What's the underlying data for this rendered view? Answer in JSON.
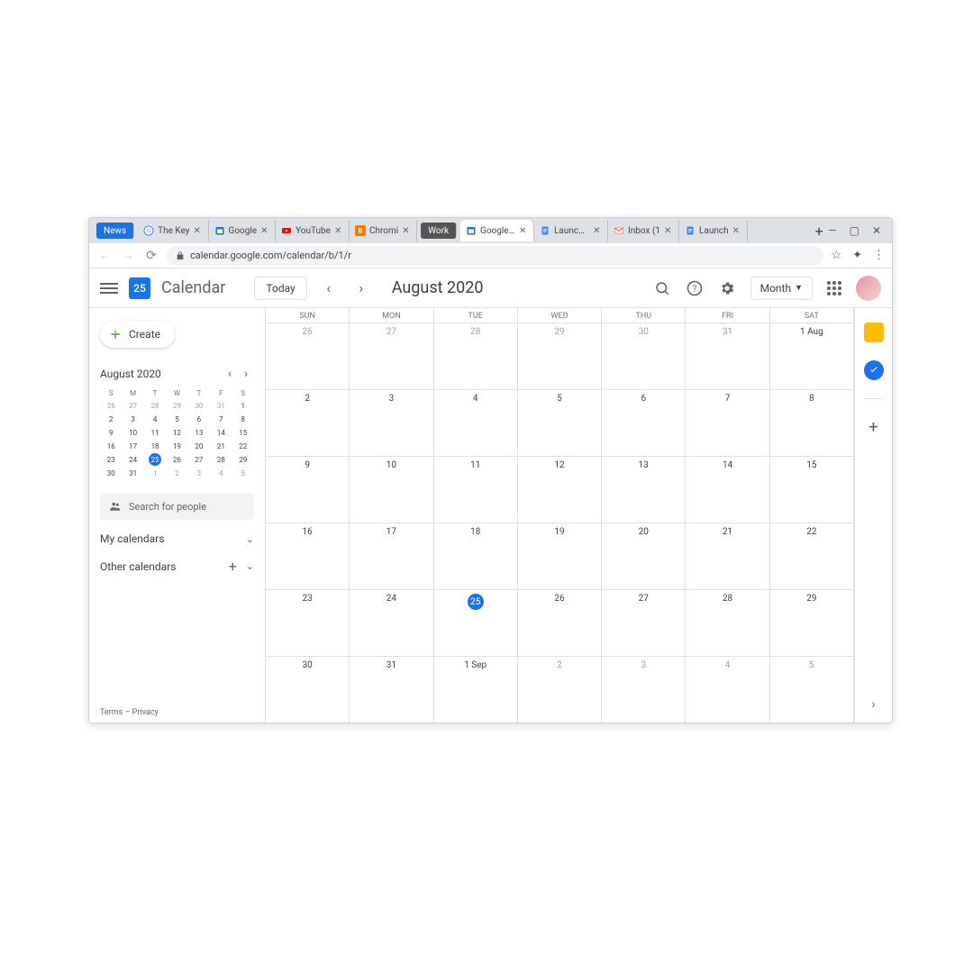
{
  "browser": {
    "tabs": [
      {
        "label": "News",
        "type": "news"
      },
      {
        "label": "The Key",
        "type": "g"
      },
      {
        "label": "Google",
        "type": "gcal"
      },
      {
        "label": "YouTube",
        "type": "yt"
      },
      {
        "label": "Chromi",
        "type": "blog"
      },
      {
        "label": "Work",
        "type": "work"
      },
      {
        "label": "Google C",
        "type": "gcal",
        "active": true
      },
      {
        "label": "Launch Pr",
        "type": "docs"
      },
      {
        "label": "Inbox (1",
        "type": "gmail"
      },
      {
        "label": "Launch",
        "type": "docs"
      }
    ],
    "url": "calendar.google.com/calendar/b/1/r"
  },
  "header": {
    "logo_day": "25",
    "title": "Calendar",
    "today": "Today",
    "month": "August 2020",
    "view": "Month"
  },
  "sidebar": {
    "create": "Create",
    "mini_month": "August 2020",
    "dow": [
      "S",
      "M",
      "T",
      "W",
      "T",
      "F",
      "S"
    ],
    "mini_rows": [
      [
        {
          "n": "26",
          "dim": true
        },
        {
          "n": "27",
          "dim": true
        },
        {
          "n": "28",
          "dim": true
        },
        {
          "n": "29",
          "dim": true
        },
        {
          "n": "30",
          "dim": true
        },
        {
          "n": "31",
          "dim": true
        },
        {
          "n": "1"
        }
      ],
      [
        {
          "n": "2"
        },
        {
          "n": "3"
        },
        {
          "n": "4"
        },
        {
          "n": "5"
        },
        {
          "n": "6"
        },
        {
          "n": "7"
        },
        {
          "n": "8"
        }
      ],
      [
        {
          "n": "9"
        },
        {
          "n": "10"
        },
        {
          "n": "11"
        },
        {
          "n": "12"
        },
        {
          "n": "13"
        },
        {
          "n": "14"
        },
        {
          "n": "15"
        }
      ],
      [
        {
          "n": "16"
        },
        {
          "n": "17"
        },
        {
          "n": "18"
        },
        {
          "n": "19"
        },
        {
          "n": "20"
        },
        {
          "n": "21"
        },
        {
          "n": "22"
        }
      ],
      [
        {
          "n": "23"
        },
        {
          "n": "24"
        },
        {
          "n": "25",
          "today": true
        },
        {
          "n": "26"
        },
        {
          "n": "27"
        },
        {
          "n": "28"
        },
        {
          "n": "29"
        }
      ],
      [
        {
          "n": "30"
        },
        {
          "n": "31"
        },
        {
          "n": "1",
          "dim": true
        },
        {
          "n": "2",
          "dim": true
        },
        {
          "n": "3",
          "dim": true
        },
        {
          "n": "4",
          "dim": true
        },
        {
          "n": "5",
          "dim": true
        }
      ]
    ],
    "search_placeholder": "Search for people",
    "my_cal": "My calendars",
    "other_cal": "Other calendars",
    "terms": "Terms",
    "privacy": "Privacy"
  },
  "grid": {
    "dow": [
      "SUN",
      "MON",
      "TUE",
      "WED",
      "THU",
      "FRI",
      "SAT"
    ],
    "rows": [
      [
        {
          "n": "26",
          "dim": true
        },
        {
          "n": "27",
          "dim": true
        },
        {
          "n": "28",
          "dim": true
        },
        {
          "n": "29",
          "dim": true
        },
        {
          "n": "30",
          "dim": true
        },
        {
          "n": "31",
          "dim": true
        },
        {
          "n": "1 Aug",
          "first": true
        }
      ],
      [
        {
          "n": "2"
        },
        {
          "n": "3"
        },
        {
          "n": "4"
        },
        {
          "n": "5"
        },
        {
          "n": "6"
        },
        {
          "n": "7"
        },
        {
          "n": "8"
        }
      ],
      [
        {
          "n": "9"
        },
        {
          "n": "10"
        },
        {
          "n": "11"
        },
        {
          "n": "12"
        },
        {
          "n": "13"
        },
        {
          "n": "14"
        },
        {
          "n": "15"
        }
      ],
      [
        {
          "n": "16"
        },
        {
          "n": "17"
        },
        {
          "n": "18"
        },
        {
          "n": "19"
        },
        {
          "n": "20"
        },
        {
          "n": "21"
        },
        {
          "n": "22"
        }
      ],
      [
        {
          "n": "23"
        },
        {
          "n": "24"
        },
        {
          "n": "25",
          "today": true
        },
        {
          "n": "26"
        },
        {
          "n": "27"
        },
        {
          "n": "28"
        },
        {
          "n": "29"
        }
      ],
      [
        {
          "n": "30"
        },
        {
          "n": "31"
        },
        {
          "n": "1 Sep",
          "first": true
        },
        {
          "n": "2",
          "dim": true
        },
        {
          "n": "3",
          "dim": true
        },
        {
          "n": "4",
          "dim": true
        },
        {
          "n": "5",
          "dim": true
        }
      ]
    ]
  }
}
